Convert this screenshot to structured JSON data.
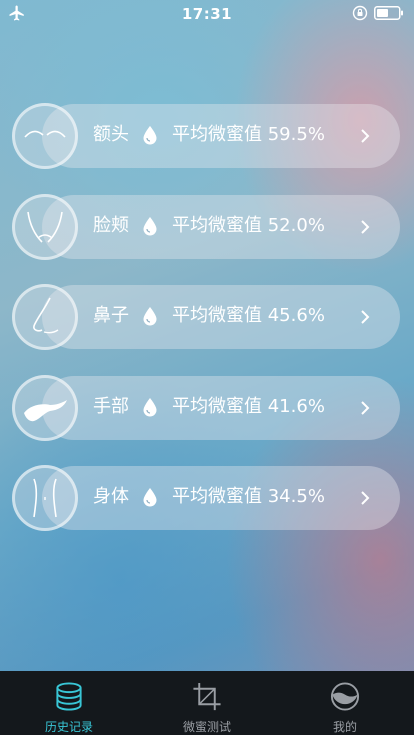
{
  "status_bar": {
    "time": "17:31"
  },
  "metric_label": "平均微蜜值",
  "items": [
    {
      "name": "额头",
      "value": "59.5%",
      "icon": "forehead-icon"
    },
    {
      "name": "脸颊",
      "value": "52.0%",
      "icon": "cheek-icon"
    },
    {
      "name": "鼻子",
      "value": "45.6%",
      "icon": "nose-icon"
    },
    {
      "name": "手部",
      "value": "41.6%",
      "icon": "hand-icon"
    },
    {
      "name": "身体",
      "value": "34.5%",
      "icon": "body-icon"
    }
  ],
  "tabs": [
    {
      "label": "历史记录",
      "icon": "database-icon",
      "active": true
    },
    {
      "label": "微蜜测试",
      "icon": "crop-icon",
      "active": false
    },
    {
      "label": "我的",
      "icon": "profile-icon",
      "active": false
    }
  ],
  "colors": {
    "active_tab": "#39c6d6",
    "inactive_tab": "#9a9ea4",
    "tab_bar_bg": "#14181c"
  }
}
